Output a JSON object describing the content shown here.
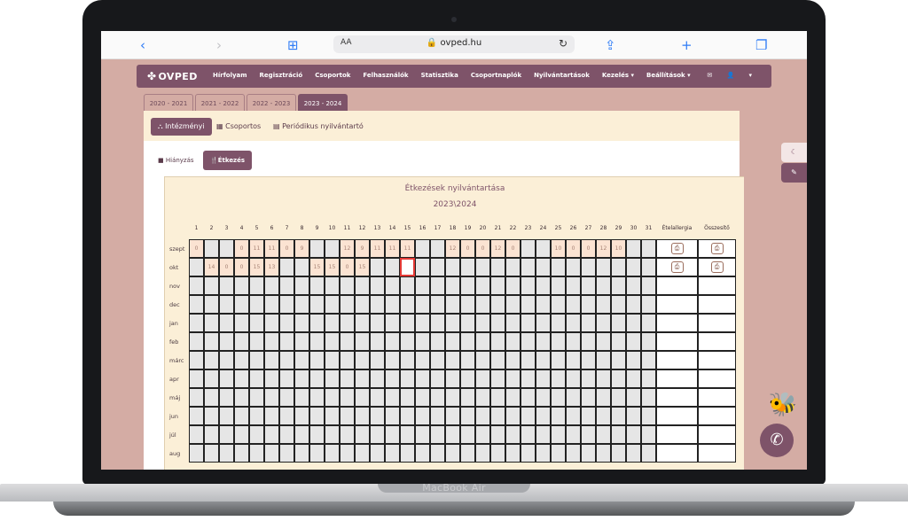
{
  "device": {
    "label": "MacBook Air"
  },
  "browser": {
    "aa": "AA",
    "url": "ovped.hu"
  },
  "nav": {
    "logo": "OVPED",
    "items": [
      "Hírfolyam",
      "Regisztráció",
      "Csoportok",
      "Felhasználók",
      "Statisztika",
      "Csoportnaplók",
      "Nyilvántartások",
      "Kezelés ▾",
      "Beállítások ▾"
    ],
    "user": "▾"
  },
  "years": [
    "2020 - 2021",
    "2021 - 2022",
    "2022 - 2023",
    "2023 - 2024"
  ],
  "active_year_index": 3,
  "panel_tabs": [
    "Intézményi",
    "Csoportos",
    "Periódikus nyilvántartó"
  ],
  "subtabs": [
    "Hiányzás",
    "Étkezés"
  ],
  "table": {
    "title": "Étkezések nyilvántartása",
    "subtitle": "2023\\2024",
    "days": [
      "1",
      "2",
      "3",
      "4",
      "5",
      "6",
      "7",
      "8",
      "9",
      "10",
      "11",
      "12",
      "13",
      "14",
      "15",
      "16",
      "17",
      "18",
      "19",
      "20",
      "21",
      "22",
      "23",
      "24",
      "25",
      "26",
      "27",
      "28",
      "29",
      "30",
      "31"
    ],
    "col_allergy": "Ételallergia",
    "col_summary": "Összesítő",
    "months": [
      "szept",
      "okt",
      "nov",
      "dec",
      "jan",
      "feb",
      "márc",
      "apr",
      "máj",
      "jun",
      "júl",
      "aug"
    ],
    "rows": {
      "szept": [
        "0",
        "",
        "",
        "0",
        "11",
        "11",
        "0",
        "9",
        "",
        "",
        "12",
        "9",
        "11",
        "11",
        "11",
        "",
        "",
        "12",
        "0",
        "0",
        "12",
        "0",
        "",
        "",
        "10",
        "0",
        "0",
        "12",
        "10",
        "",
        ""
      ],
      "okt": [
        "",
        "14",
        "0",
        "0",
        "15",
        "13",
        "",
        "",
        "15",
        "15",
        "0",
        "15",
        "",
        "",
        "",
        "",
        "",
        "",
        "",
        "",
        "",
        "",
        "",
        "",
        "",
        "",
        "",
        "",
        "",
        "",
        ""
      ]
    },
    "selected_cell": {
      "month": "okt",
      "day": 15
    }
  }
}
